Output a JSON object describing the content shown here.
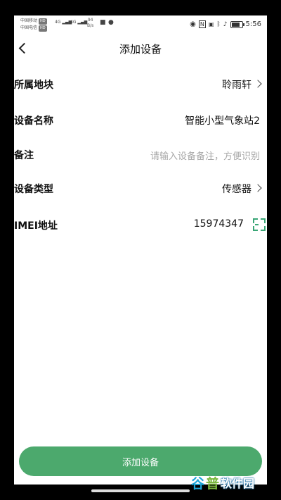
{
  "status_bar": {
    "carrier1": "中国移动",
    "carrier2": "中国电信",
    "hd": "HD",
    "signal1": "4G",
    "signal2": "4G",
    "speed_value": "94",
    "speed_unit": "B/s",
    "time": "5:56",
    "battery_level": 0.8
  },
  "header": {
    "title": "添加设备"
  },
  "form": {
    "plot": {
      "label": "所属地块",
      "value": "聆雨轩"
    },
    "device_name": {
      "label": "设备名称",
      "value": "智能小型气象站2"
    },
    "remark": {
      "label": "备注",
      "placeholder": "请输入设备备注，方便识别"
    },
    "device_type": {
      "label": "设备类型",
      "value": "传感器"
    },
    "imei": {
      "label": "IMEI地址",
      "value": "15974347"
    }
  },
  "submit_label": "添加设备",
  "watermark": {
    "part1": "谷",
    "part2": "普",
    "part3": "软件园"
  }
}
